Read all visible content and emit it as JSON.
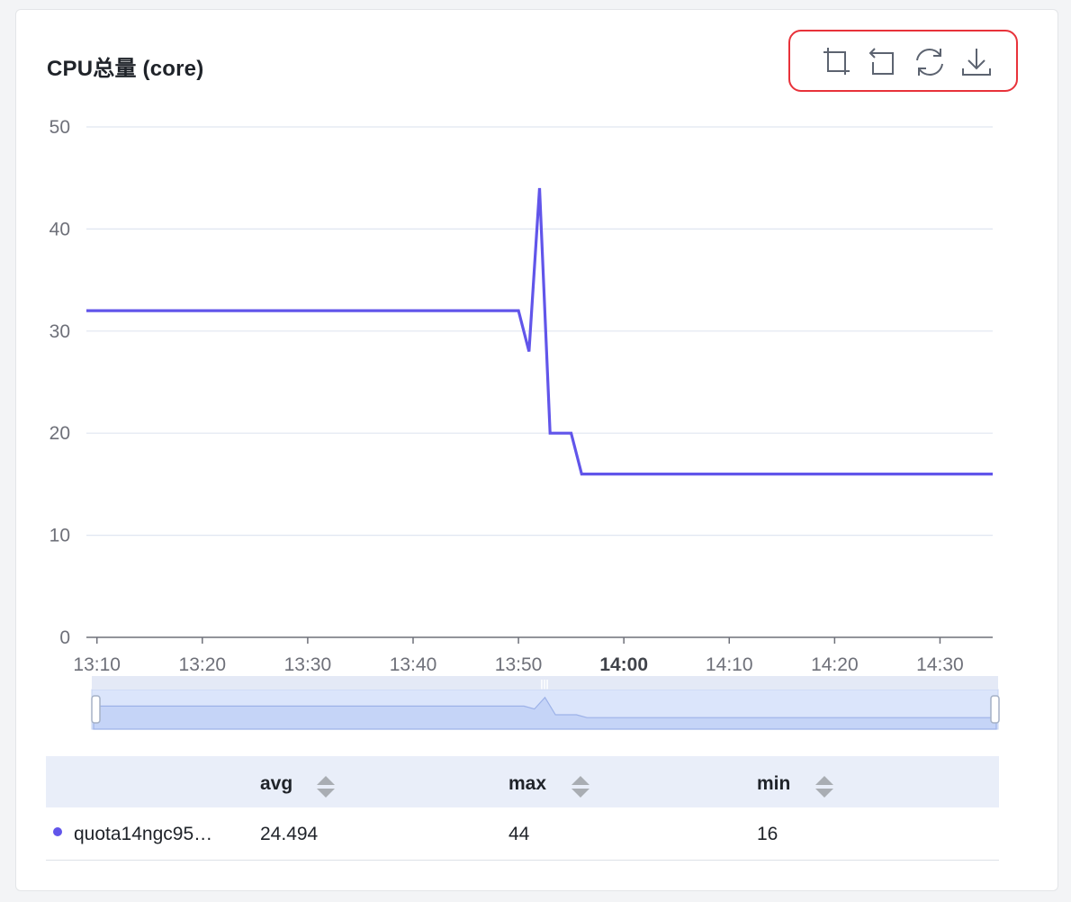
{
  "panel": {
    "title": "CPU总量 (core)"
  },
  "toolbar": {
    "items": [
      {
        "icon": "crop-icon",
        "label": "area zoom"
      },
      {
        "icon": "zoom-reset-icon",
        "label": "restore zoom"
      },
      {
        "icon": "refresh-icon",
        "label": "refresh"
      },
      {
        "icon": "download-icon",
        "label": "download"
      }
    ]
  },
  "colors": {
    "series": "#6155ea",
    "grid": "#e0e6f1",
    "axis": "#6e7079",
    "toolbar_highlight": "#e8323a",
    "table_header_bg": "#e9eef9"
  },
  "chart_data": {
    "type": "line",
    "title": "CPU总量 (core)",
    "xlabel": "",
    "ylabel": "",
    "ylim": [
      0,
      50
    ],
    "yticks": [
      0,
      10,
      20,
      30,
      40,
      50
    ],
    "xtick_labels": [
      "13:10",
      "13:20",
      "13:30",
      "13:40",
      "13:50",
      "14:00",
      "14:10",
      "14:20",
      "14:30"
    ],
    "xtick_bold": "14:00",
    "xlim": [
      "13:09",
      "14:35"
    ],
    "grid": true,
    "series": [
      {
        "name": "quota14ngc95…",
        "color": "#6155ea",
        "points": [
          {
            "x": "13:09",
            "y": 32
          },
          {
            "x": "13:50",
            "y": 32
          },
          {
            "x": "13:51",
            "y": 28
          },
          {
            "x": "13:52",
            "y": 44
          },
          {
            "x": "13:53",
            "y": 20
          },
          {
            "x": "13:55",
            "y": 20
          },
          {
            "x": "13:56",
            "y": 16
          },
          {
            "x": "14:35",
            "y": 16
          }
        ]
      }
    ]
  },
  "table": {
    "columns": [
      "avg",
      "max",
      "min"
    ],
    "rows": [
      {
        "name": "quota14ngc95…",
        "avg": "24.494",
        "max": "44",
        "min": "16"
      }
    ]
  }
}
